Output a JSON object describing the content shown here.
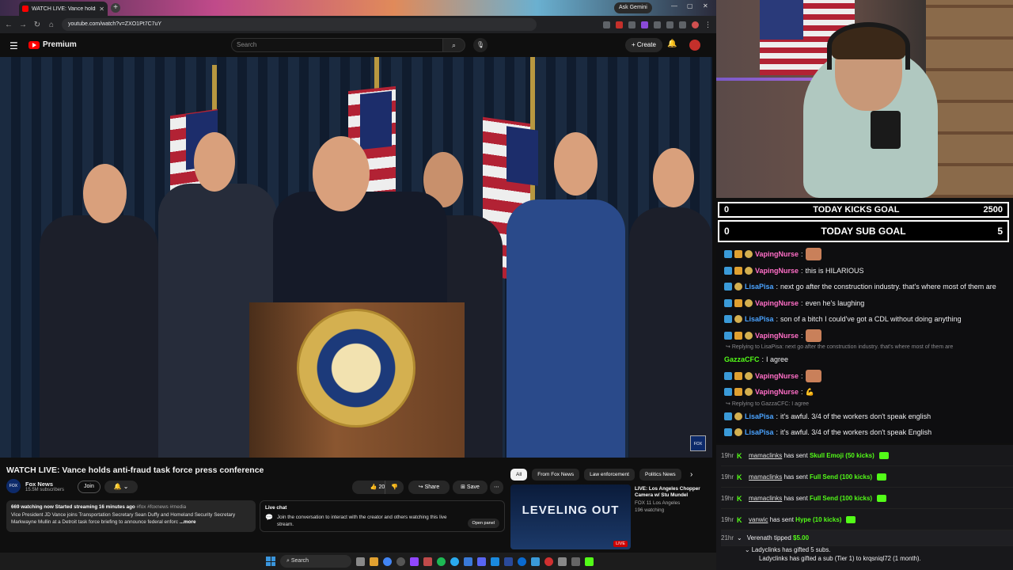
{
  "browser": {
    "tab_title": "WATCH LIVE: Vance holds",
    "ask_gemini": "Ask Gemini",
    "url": "youtube.com/watch?v=ZXO1Pt7C7uY"
  },
  "youtube": {
    "brand": "Premium",
    "search_placeholder": "Search",
    "create_label": "Create",
    "video_title": "WATCH LIVE: Vance holds anti-fraud task force press conference",
    "channel_name": "Fox News",
    "channel_subs": "15.5M subscribers",
    "join_label": "Join",
    "like_count": "20",
    "share_label": "Share",
    "save_label": "Save",
    "bug_text": "FOX NEWS",
    "description": {
      "stats": "669 watching now  Started streaming 16 minutes ago",
      "tags": "#fox #foxnews #media",
      "body": "Vice President JD Vance joins Transportation Secretary Sean Duffy and Homeland Security Secretary Markwayne Mullin at a Detroit task force briefing to announce federal enforc",
      "more": "...more"
    },
    "livechat": {
      "title": "Live chat",
      "body": "Join the conversation to interact with the creator and others watching this live stream.",
      "open_panel": "Open panel"
    },
    "chips": [
      "All",
      "From Fox News",
      "Law enforcement",
      "Politics News"
    ],
    "rec": {
      "thumb_text": "LEVELING OUT",
      "live_badge": "LIVE",
      "title": "LIVE: Los Angeles Chopper Camera w/ Stu Mundel",
      "channel": "FOX 11 Los Angeles",
      "views": "196 watching"
    }
  },
  "taskbar": {
    "search": "Search"
  },
  "goals": [
    {
      "left": "0",
      "label": "TODAY KICKS GOAL",
      "right": "2500"
    },
    {
      "left": "0",
      "label": "TODAY SUB GOAL",
      "right": "5"
    }
  ],
  "chat": [
    {
      "user": "VapingNurse",
      "color": "#ff6ec7",
      "text": "",
      "emote": true
    },
    {
      "user": "VapingNurse",
      "color": "#ff6ec7",
      "text": "this is HILARIOUS"
    },
    {
      "user": "LisaPisa",
      "color": "#4aa3ff",
      "text": "next go after the construction industry. that's where most of them are"
    },
    {
      "user": "VapingNurse",
      "color": "#ff6ec7",
      "text": "even he's laughing"
    },
    {
      "user": "LisaPisa",
      "color": "#4aa3ff",
      "text": "son of a bitch I could've got a CDL without doing anything"
    },
    {
      "user": "VapingNurse",
      "color": "#ff6ec7",
      "text": "",
      "emote": true
    },
    {
      "reply": "Replying to LisaPisa: next go after the construction industry. that's where most of them are"
    },
    {
      "user": "GazzaCFC",
      "color": "#53fc18",
      "text": "I agree"
    },
    {
      "user": "VapingNurse",
      "color": "#ff6ec7",
      "text": "",
      "emote": true
    },
    {
      "user": "VapingNurse",
      "color": "#ff6ec7",
      "text": "💪"
    },
    {
      "reply": "Replying to GazzaCFC: I agree"
    },
    {
      "user": "LisaPisa",
      "color": "#4aa3ff",
      "text": "it's awful. 3/4 of the workers don't speak english"
    },
    {
      "user": "LisaPisa",
      "color": "#4aa3ff",
      "text": "it's awful. 3/4 of the workers don't speak English"
    }
  ],
  "events": [
    {
      "time": "19hr",
      "who": "mamaclinks",
      "text": "has sent",
      "gift": "Skull Emoji (50 kicks)"
    },
    {
      "time": "19hr",
      "who": "mamaclinks",
      "text": "has sent",
      "gift": "Full Send (100 kicks)"
    },
    {
      "time": "19hr",
      "who": "mamaclinks",
      "text": "has sent",
      "gift": "Full Send (100 kicks)"
    },
    {
      "time": "19hr",
      "who": "vanwic",
      "text": "has sent",
      "gift": "Hype (10 kicks)"
    }
  ],
  "tip": {
    "time": "21hr",
    "who": "Verenath",
    "text": "tipped",
    "amount": "$5.00"
  },
  "subs": {
    "parent": "Ladyclinks has gifted 5 subs.",
    "child": "Ladyclinks has gifted a sub (Tier 1) to krqsniql72 (1 month)."
  }
}
